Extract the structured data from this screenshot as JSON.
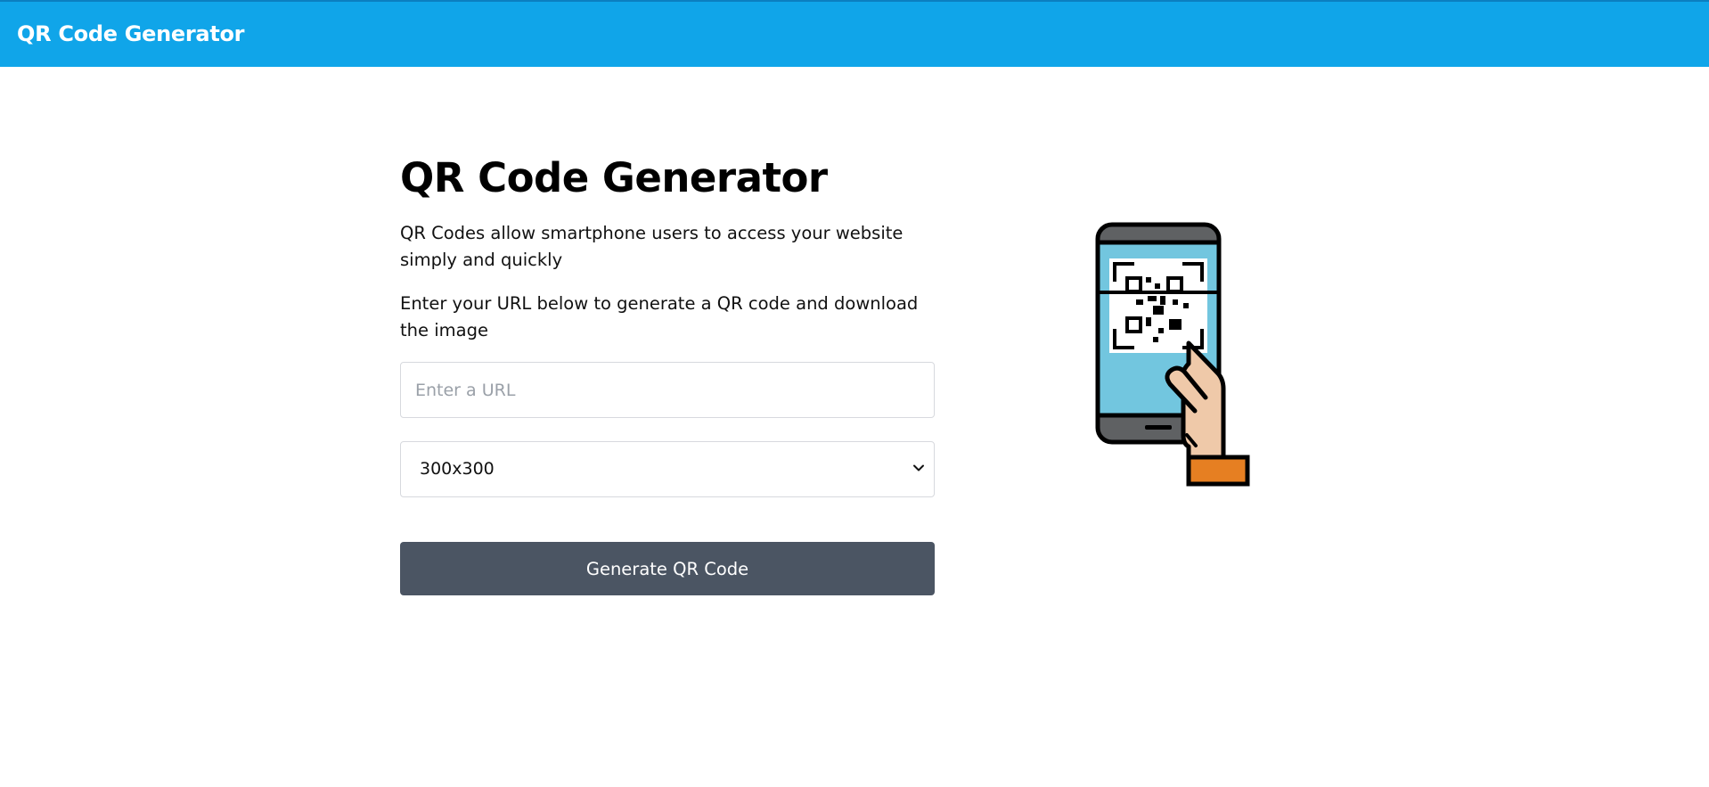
{
  "header": {
    "brand": "QR Code Generator",
    "background_color": "#10a5e9"
  },
  "main": {
    "title": "QR Code Generator",
    "description": "QR Codes allow smartphone users to access your website simply and quickly",
    "instruction": "Enter your URL below to generate a QR code and download the image",
    "url_input": {
      "value": "",
      "placeholder": "Enter a URL"
    },
    "size_select": {
      "selected": "300x300",
      "icon": "chevron-down-icon"
    },
    "generate_button": {
      "label": "Generate QR Code",
      "color": "#4b5563"
    }
  },
  "illustration": {
    "icon": "phone-scanning-qr-icon"
  }
}
